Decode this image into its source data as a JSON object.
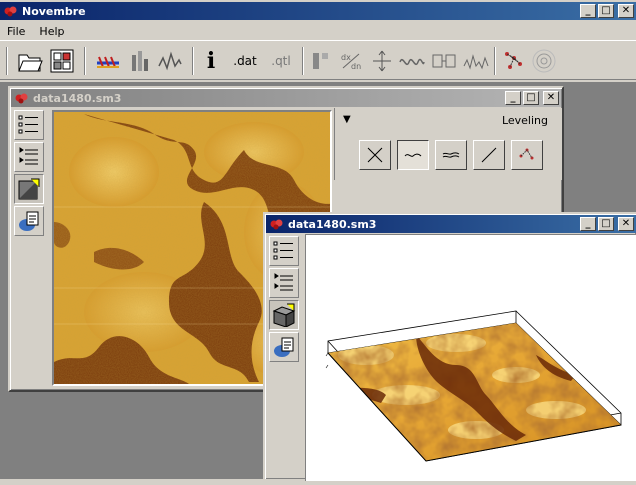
{
  "app": {
    "title": "Novembre"
  },
  "menu": {
    "items": [
      "File",
      "Help"
    ]
  },
  "toolbar": {
    "dat_label": ".dat",
    "qtl_label": ".qtl"
  },
  "window_2d": {
    "title": "data1480.sm3"
  },
  "window_3d": {
    "title": "data1480.sm3"
  },
  "leveling": {
    "collapse_glyph": "▼",
    "label": "Leveling"
  },
  "window_buttons": {
    "minimize": "_",
    "maximize": "□",
    "close": "✕"
  },
  "colors": {
    "titlebar_active": "#0a246a",
    "surface_light": "#f0c04a",
    "surface_dark": "#6a2a08"
  }
}
